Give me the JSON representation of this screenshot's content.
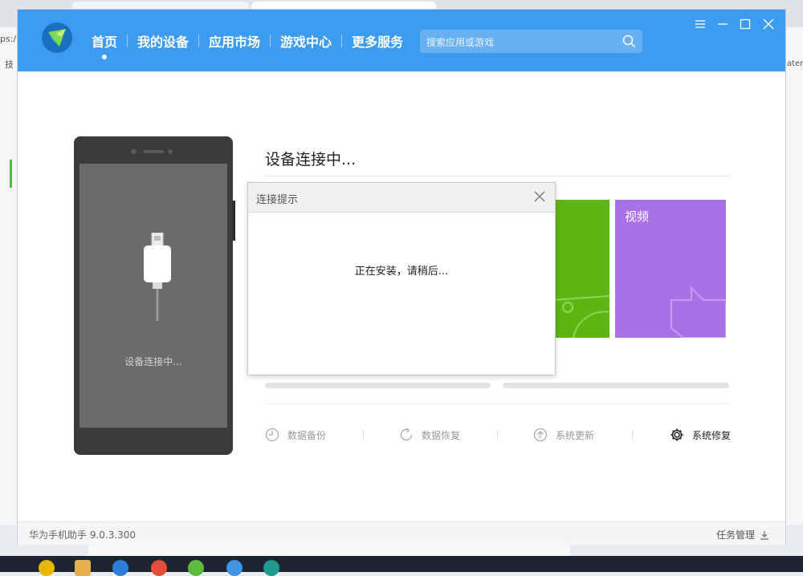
{
  "app": {
    "nav": [
      {
        "label": "首页",
        "active": true
      },
      {
        "label": "我的设备"
      },
      {
        "label": "应用市场"
      },
      {
        "label": "游戏中心"
      },
      {
        "label": "更多服务"
      }
    ],
    "search_placeholder": "搜索应用或游戏",
    "brand_color": "#3d9bf0"
  },
  "phone": {
    "status_text": "设备连接中..."
  },
  "main": {
    "title": "设备连接中...",
    "tiles": [
      {
        "label": "",
        "color": "#5db510"
      },
      {
        "label": "视频",
        "color": "#a971e6"
      }
    ],
    "tools": [
      {
        "label": "数据备份",
        "icon": "clock-icon"
      },
      {
        "label": "数据恢复",
        "icon": "restore-icon"
      },
      {
        "label": "系统更新",
        "icon": "upload-icon"
      },
      {
        "label": "系统修复",
        "icon": "gear-icon"
      }
    ]
  },
  "dialog": {
    "title": "连接提示",
    "message": "正在安装，请稍后..."
  },
  "status": {
    "version": "华为手机助手 9.0.3.300",
    "task_manager": "任务管理"
  },
  "background": {
    "left_texts": [
      "ps:/",
      "技"
    ],
    "right_text": "ater"
  }
}
